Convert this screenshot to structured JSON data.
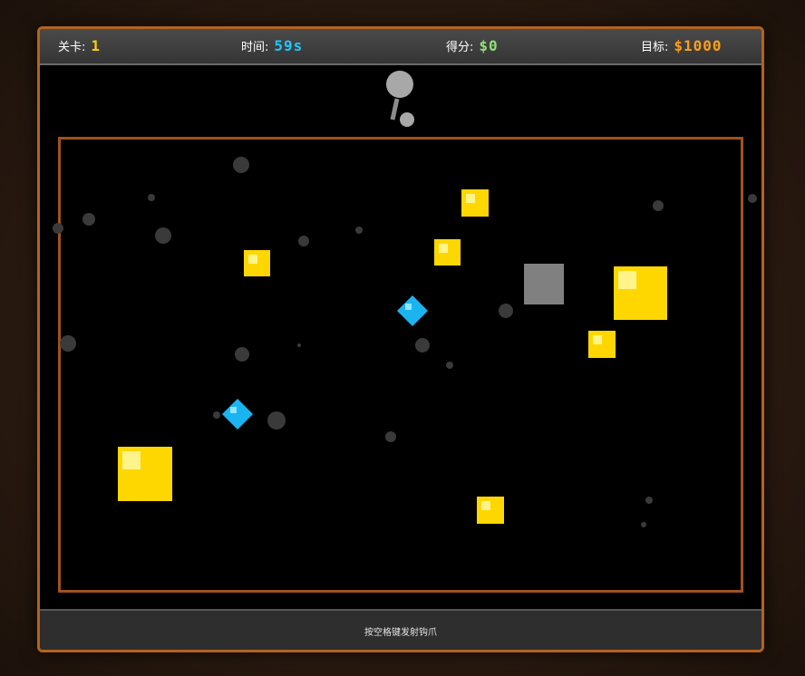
{
  "hud": {
    "level_label": "关卡:",
    "level_value": "1",
    "time_label": "时间:",
    "time_value": "59s",
    "score_label": "得分:",
    "score_value": "$0",
    "goal_label": "目标:",
    "goal_value": "$1000"
  },
  "colors": {
    "level": "#ffd000",
    "time": "#1ec8ff",
    "score": "#8fe07a",
    "goal": "#ff9f1a",
    "gold": "#ffd700",
    "gold_highlight": "#fff48a",
    "diamond": "#1ab4f0",
    "diamond_highlight": "#8ee6ff",
    "rock": "#808080",
    "border": "#a0521c"
  },
  "footer": {
    "hint": "按空格键发射钩爪"
  },
  "items": [
    {
      "type": "gold",
      "name": "gold-nugget-small-1"
    },
    {
      "type": "gold",
      "name": "gold-nugget-small-2"
    },
    {
      "type": "gold",
      "name": "gold-nugget-small-3"
    },
    {
      "type": "gold",
      "name": "gold-nugget-large-1"
    },
    {
      "type": "gold",
      "name": "gold-nugget-small-4"
    },
    {
      "type": "gold",
      "name": "gold-nugget-large-2"
    },
    {
      "type": "gold",
      "name": "gold-nugget-small-5"
    },
    {
      "type": "rock",
      "name": "stone-block"
    },
    {
      "type": "diamond",
      "name": "diamond-1"
    },
    {
      "type": "diamond",
      "name": "diamond-2"
    }
  ]
}
